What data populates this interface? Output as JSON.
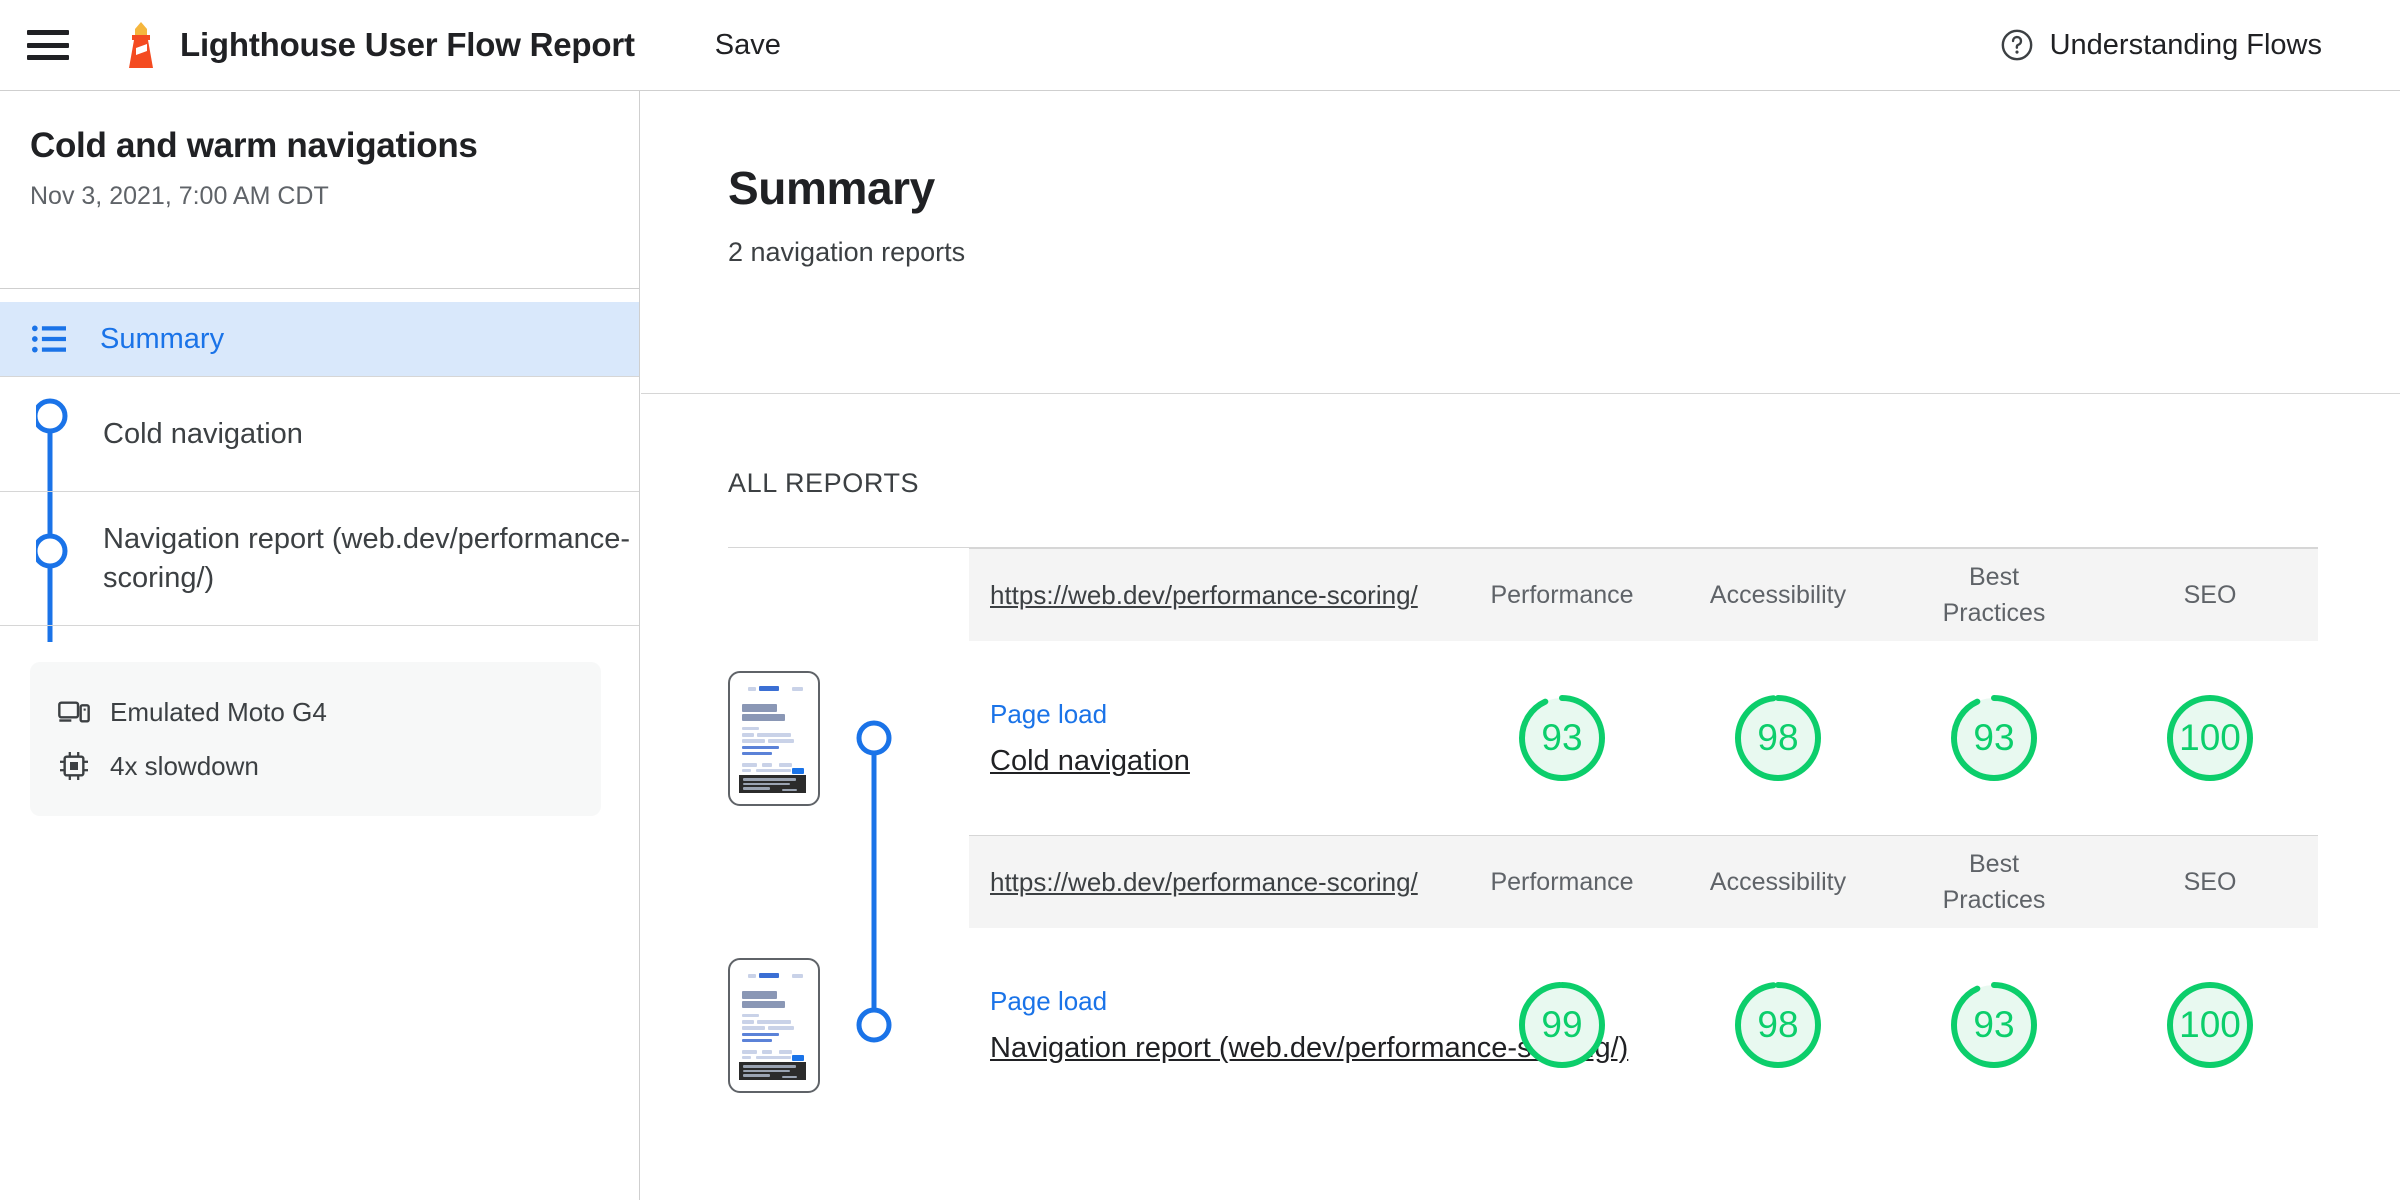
{
  "topbar": {
    "menu_icon": "hamburger-menu-icon",
    "logo_icon": "lighthouse-logo",
    "title": "Lighthouse User Flow Report",
    "save_label": "Save",
    "help_icon": "help-circle-icon",
    "help_label": "Understanding Flows"
  },
  "sidebar": {
    "flow_title": "Cold and warm navigations",
    "flow_date": "Nov 3, 2021, 7:00 AM CDT",
    "summary_item": {
      "label": "Summary",
      "icon": "list-icon",
      "selected": true
    },
    "steps": [
      {
        "label": "Cold navigation"
      },
      {
        "label": "Navigation report (web.dev/performance-scoring/)"
      }
    ],
    "device_info": [
      {
        "icon": "device-emulation-icon",
        "label": "Emulated Moto G4"
      },
      {
        "icon": "cpu-chip-icon",
        "label": "4x slowdown"
      }
    ]
  },
  "main": {
    "title": "Summary",
    "subtitle": "2 navigation reports",
    "section_label": "ALL REPORTS",
    "categories": [
      "Performance",
      "Accessibility",
      "Best Practices",
      "SEO"
    ],
    "reports": [
      {
        "url": "https://web.dev/performance-scoring/",
        "kind": "Page load",
        "name": "Cold navigation",
        "scores": [
          93,
          98,
          93,
          100
        ]
      },
      {
        "url": "https://web.dev/performance-scoring/",
        "kind": "Page load",
        "name": "Navigation report (web.dev/performance-scoring/)",
        "scores": [
          99,
          98,
          93,
          100
        ]
      }
    ]
  },
  "colors": {
    "accent_blue": "#1a73e8",
    "score_green": "#0cce6b",
    "score_green_bg": "#e8f9f0",
    "lighthouse_orange": "#f44b21",
    "lighthouse_yellow": "#f5b63d",
    "selected_bg": "#d9e8fb"
  }
}
